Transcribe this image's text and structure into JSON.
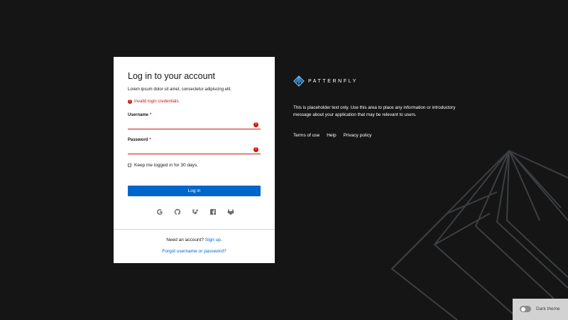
{
  "colors": {
    "page_background": "#151515",
    "card_background": "#ffffff",
    "primary": "#0066cc",
    "danger": "#c9190b",
    "brand_accent": "#73bcf7"
  },
  "login": {
    "title": "Log in to your account",
    "description": "Lorem ipsum dolor sit amet, consectetur adipiscing elit.",
    "error_message": "Invalid login credentials.",
    "username_label": "Username",
    "username_value": "",
    "password_label": "Password",
    "password_value": "",
    "required_marker": "*",
    "keep_logged_in_label": "Keep me logged in for 30 days.",
    "keep_logged_in_checked": false,
    "login_button_label": "Log in",
    "social_icons": [
      "google-icon",
      "github-icon",
      "dropbox-icon",
      "facebook-icon",
      "gitlab-icon"
    ],
    "need_account_text": "Need an account?",
    "sign_up_link": "Sign up.",
    "forgot_link": "Forgot username or password?"
  },
  "brand": {
    "name": "PATTERNFLY",
    "icon": "patternfly-logo"
  },
  "info": {
    "placeholder_text": "This is placeholder text only. Use this area to place any information or introductory message about your application that may be relevant to users.",
    "footer_links": [
      "Terms of use",
      "Help",
      "Privacy policy"
    ]
  },
  "theme_toggle": {
    "label": "Dark theme",
    "on": false
  }
}
